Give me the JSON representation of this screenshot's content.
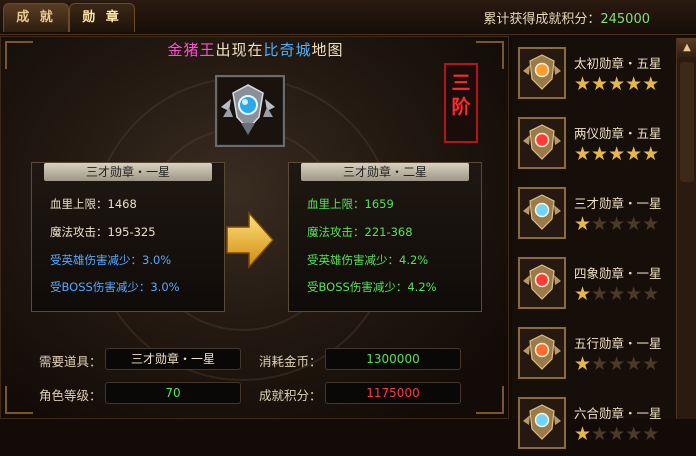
{
  "tabs": [
    {
      "label": "成 就"
    },
    {
      "label": "勋 章"
    }
  ],
  "header": {
    "score_label": "累计获得成就积分：",
    "score_value": "245000"
  },
  "banner": {
    "part1": "金猪王",
    "part2": "出现在",
    "part3": "比奇城",
    "part4": "地图"
  },
  "rank_badge": {
    "line1": "三",
    "line2": "阶"
  },
  "current_card": {
    "title": "三才勋章・一星",
    "stats": [
      {
        "label": "血里上限：",
        "value": "1468"
      },
      {
        "label": "魔法攻击：",
        "value": "195-325"
      },
      {
        "label": "受英雄伤害减少：",
        "value": "3.0%"
      },
      {
        "label": "受BOSS伤害减少：",
        "value": "3.0%"
      }
    ]
  },
  "next_card": {
    "title": "三才勋章・二星",
    "stats": [
      {
        "label": "血里上限：",
        "value": "1659"
      },
      {
        "label": "魔法攻击：",
        "value": "221-368"
      },
      {
        "label": "受英雄伤害减少：",
        "value": "4.2%"
      },
      {
        "label": "受BOSS伤害减少：",
        "value": "4.2%"
      }
    ]
  },
  "requirements": {
    "item_label": "需要道具：",
    "item_value": "三才勋章・一星",
    "gold_label": "消耗金币：",
    "gold_value": "1300000",
    "level_label": "角色等级：",
    "level_value": "70",
    "points_label": "成就积分：",
    "points_value": "1175000"
  },
  "medal_list": [
    {
      "name": "太初勋章・五星",
      "stars": 5,
      "gem": "#ff9a2e"
    },
    {
      "name": "两仪勋章・五星",
      "stars": 5,
      "gem": "#ff3a3a"
    },
    {
      "name": "三才勋章・一星",
      "stars": 1,
      "gem": "#6fd4ff"
    },
    {
      "name": "四象勋章・一星",
      "stars": 1,
      "gem": "#ff3a3a"
    },
    {
      "name": "五行勋章・一星",
      "stars": 1,
      "gem": "#ff6a2e"
    },
    {
      "name": "六合勋章・一星",
      "stars": 1,
      "gem": "#6fd4ff"
    }
  ],
  "colors": {
    "score_value": "#7fe07a",
    "current_cost": "#57e05a",
    "insufficient": "#ff3a3a"
  }
}
